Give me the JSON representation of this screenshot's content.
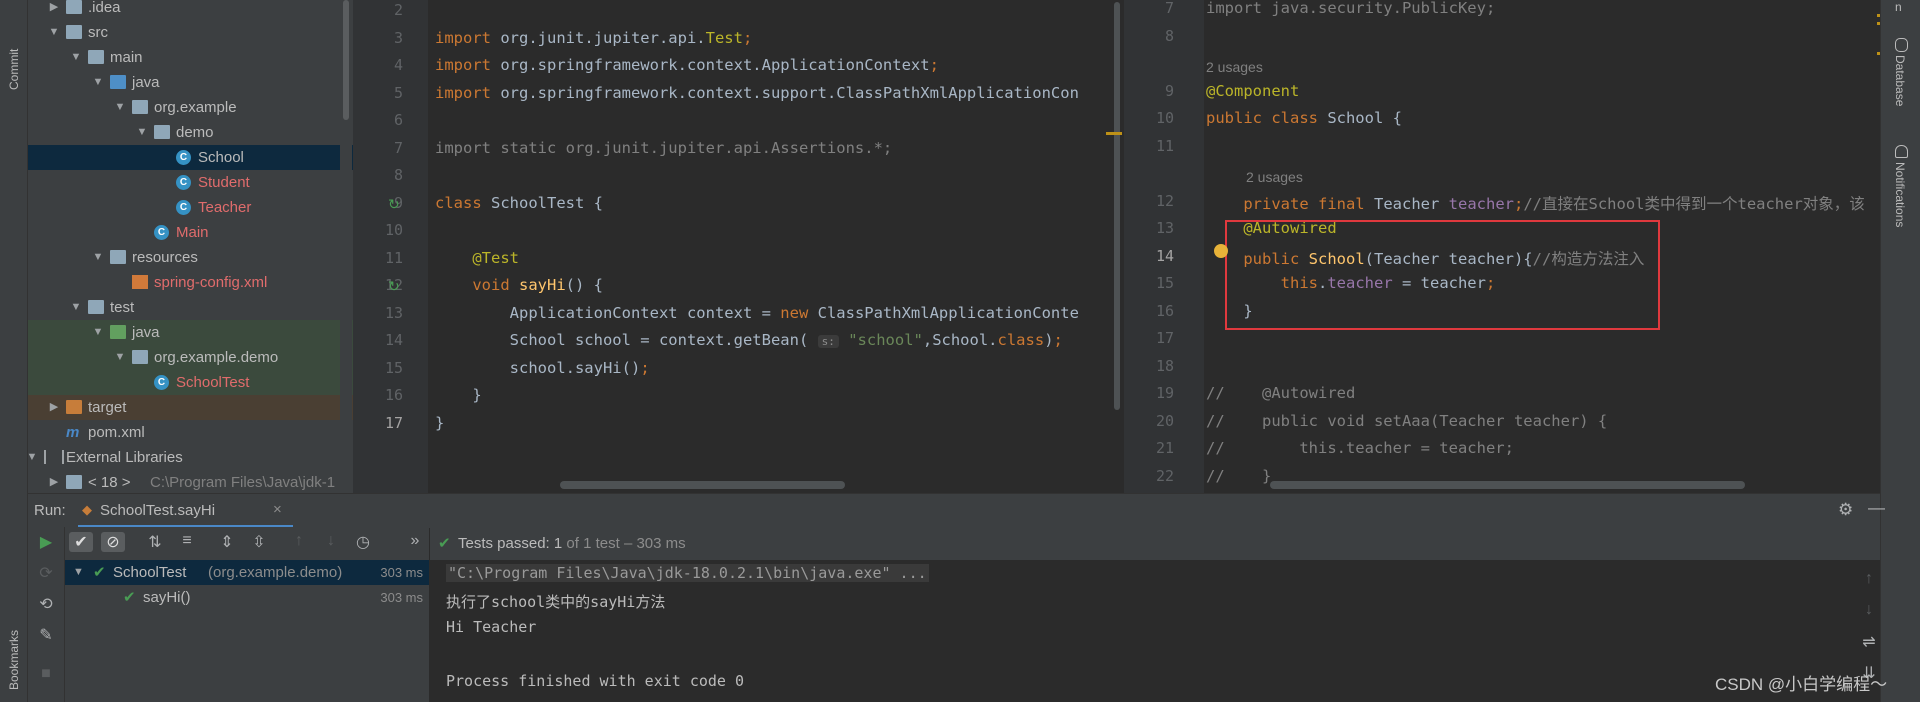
{
  "left_strip": {
    "commit": "Commit",
    "bookmarks": "Bookmarks"
  },
  "right_strip": {
    "database": "Database",
    "notifications": "Notifications",
    "top_label": "n"
  },
  "project_tree": [
    {
      "label": ".idea",
      "indent": 1,
      "type": "folder",
      "arrow": "right"
    },
    {
      "label": "src",
      "indent": 1,
      "type": "folder",
      "arrow": "down"
    },
    {
      "label": "main",
      "indent": 2,
      "type": "folder",
      "arrow": "down"
    },
    {
      "label": "java",
      "indent": 3,
      "type": "folder-blue",
      "arrow": "down"
    },
    {
      "label": "org.example",
      "indent": 4,
      "type": "package",
      "arrow": "down"
    },
    {
      "label": "demo",
      "indent": 5,
      "type": "package",
      "arrow": "down"
    },
    {
      "label": "School",
      "indent": 6,
      "type": "class",
      "selected": true
    },
    {
      "label": "Student",
      "indent": 6,
      "type": "class",
      "red": true
    },
    {
      "label": "Teacher",
      "indent": 6,
      "type": "class",
      "red": true
    },
    {
      "label": "Main",
      "indent": 5,
      "type": "class",
      "red": true
    },
    {
      "label": "resources",
      "indent": 3,
      "type": "folder-res",
      "arrow": "down"
    },
    {
      "label": "spring-config.xml",
      "indent": 4,
      "type": "xml",
      "red": true
    },
    {
      "label": "test",
      "indent": 2,
      "type": "folder",
      "arrow": "down"
    },
    {
      "label": "java",
      "indent": 3,
      "type": "folder-green",
      "arrow": "down",
      "green_bg": true
    },
    {
      "label": "org.example.demo",
      "indent": 4,
      "type": "package",
      "arrow": "down",
      "green_bg": true
    },
    {
      "label": "SchoolTest",
      "indent": 5,
      "type": "class",
      "red": true,
      "green_bg": true
    },
    {
      "label": "target",
      "indent": 1,
      "type": "folder-orange",
      "arrow": "right",
      "orange_bg": true
    },
    {
      "label": "pom.xml",
      "indent": 1,
      "type": "maven"
    },
    {
      "label": "External Libraries",
      "indent": 0,
      "type": "libs",
      "arrow": "down"
    },
    {
      "label": "< 18 >",
      "extra": "C:\\Program Files\\Java\\jdk-1",
      "indent": 1,
      "type": "jdk",
      "arrow": "right"
    }
  ],
  "left_editor": {
    "lines": [
      {
        "n": "2",
        "html": ""
      },
      {
        "n": "3",
        "html": "<span class='kw'>import</span> org.junit.jupiter.api.<span class='ann'>Test</span><span class='kw'>;</span>"
      },
      {
        "n": "4",
        "html": "<span class='kw'>import</span> org.springframework.context.ApplicationContext<span class='kw'>;</span>"
      },
      {
        "n": "5",
        "html": "<span class='kw'>import</span> org.springframework.context.support.ClassPathXmlApplicationCon"
      },
      {
        "n": "6",
        "html": ""
      },
      {
        "n": "7",
        "html": "<span class='cmt'>import static org.junit.jupiter.api.Assertions.*;</span>"
      },
      {
        "n": "8",
        "html": ""
      },
      {
        "n": "9",
        "html": "<span class='kw'>class</span> SchoolTest {"
      },
      {
        "n": "10",
        "html": ""
      },
      {
        "n": "11",
        "html": "    <span class='ann'>@Test</span>"
      },
      {
        "n": "12",
        "html": "    <span class='kw'>void</span> <span class='fn'>sayHi</span>() {"
      },
      {
        "n": "13",
        "html": "        ApplicationContext context = <span class='kw'>new</span> ClassPathXmlApplicationConte"
      },
      {
        "n": "14",
        "html": "        School school = context.getBean( <span class='hint'>s:</span> <span class='str'>\"school\"</span>,School.<span class='kw'>class</span>)<span class='kw'>;</span>"
      },
      {
        "n": "15",
        "html": "        school.sayHi()<span class='kw'>;</span>"
      },
      {
        "n": "16",
        "html": "    }"
      },
      {
        "n": "17",
        "html": "}"
      }
    ]
  },
  "right_editor": {
    "rows": [
      {
        "kind": "line",
        "n": "7",
        "html": "<span class='cmt'>import java.security.PublicKey;</span>"
      },
      {
        "kind": "line",
        "n": "8",
        "html": ""
      },
      {
        "kind": "usage",
        "text": "2 usages",
        "indent": 0
      },
      {
        "kind": "line",
        "n": "9",
        "html": "<span class='ann'>@Component</span>"
      },
      {
        "kind": "line",
        "n": "10",
        "html": "<span class='kw'>public class</span> School {"
      },
      {
        "kind": "line",
        "n": "11",
        "html": ""
      },
      {
        "kind": "usage",
        "text": "2 usages",
        "indent": 1
      },
      {
        "kind": "line",
        "n": "12",
        "html": "    <span class='kw'>private final</span> Teacher <span class='fld'>teacher</span><span class='kw'>;</span><span class='cmt'>//直接在School类中得到一个teacher对象，该</span>"
      },
      {
        "kind": "line",
        "n": "13",
        "html": "    <span class='ann'>@Autowired</span>"
      },
      {
        "kind": "line",
        "n": "14",
        "html": "    <span class='kw'>public</span> <span class='fn'>School</span>(Teacher teacher){<span class='cmt'>//构造方法注入</span>"
      },
      {
        "kind": "line",
        "n": "15",
        "html": "        <span class='kw'>this</span>.<span class='fld'>teacher</span> = teacher<span class='kw'>;</span>"
      },
      {
        "kind": "line",
        "n": "16",
        "html": "    }"
      },
      {
        "kind": "line",
        "n": "17",
        "html": ""
      },
      {
        "kind": "line",
        "n": "18",
        "html": ""
      },
      {
        "kind": "line",
        "n": "19",
        "html": "<span class='cmt'>//    @Autowired</span>"
      },
      {
        "kind": "line",
        "n": "20",
        "html": "<span class='cmt'>//    public void setAaa(Teacher teacher) {</span>"
      },
      {
        "kind": "line",
        "n": "21",
        "html": "<span class='cmt'>//        this.teacher = teacher;</span>"
      },
      {
        "kind": "line",
        "n": "22",
        "html": "<span class='cmt'>//    }</span>"
      }
    ]
  },
  "run": {
    "label": "Run:",
    "tab_title": "SchoolTest.sayHi",
    "status_text": "Tests passed:",
    "status_count": "1",
    "status_rest": "of 1 test – 303 ms",
    "tree": [
      {
        "name": "SchoolTest",
        "detail": "(org.example.demo)",
        "time": "303 ms"
      },
      {
        "name": "sayHi()",
        "detail": "",
        "time": "303 ms"
      }
    ],
    "console": [
      "\"C:\\Program Files\\Java\\jdk-18.0.2.1\\bin\\java.exe\" ...",
      "执行了school类中的sayHi方法",
      "Hi Teacher",
      "",
      "Process finished with exit code 0"
    ]
  },
  "watermark": "CSDN @小白学编程～",
  "colors": {
    "highlight_box": "#e0393e",
    "selected_row": "#0d293e",
    "test_green": "#499c54"
  }
}
